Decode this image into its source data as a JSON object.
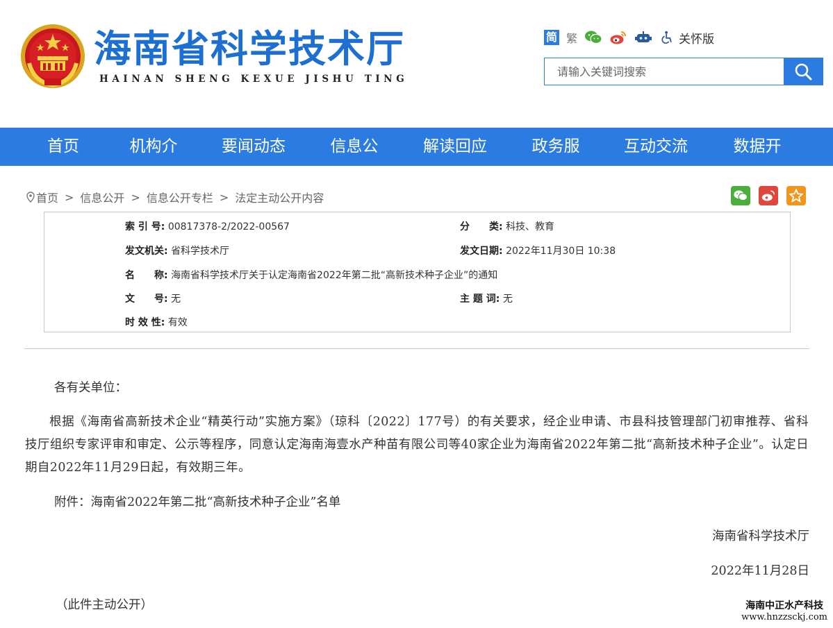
{
  "header": {
    "site_title": "海南省科学技术厅",
    "site_pinyin": "HAINAN SHENG KEXUE JISHU TING",
    "tools": {
      "simplified": "简",
      "traditional": "繁",
      "care_mode": "关怀版"
    },
    "search": {
      "placeholder": "请输入关键词搜索"
    }
  },
  "nav": {
    "items": [
      {
        "label": "首页"
      },
      {
        "label": "机构介绍"
      },
      {
        "label": "要闻动态"
      },
      {
        "label": "信息公开"
      },
      {
        "label": "解读回应"
      },
      {
        "label": "政务服务"
      },
      {
        "label": "互动交流"
      },
      {
        "label": "数据开放"
      }
    ]
  },
  "breadcrumb": [
    "首页",
    "信息公开",
    "信息公开专栏",
    "法定主动公开内容"
  ],
  "info": {
    "index_label": "索 引 号:",
    "index_value": "00817378-2/2022-00567",
    "category_label": "分　　类:",
    "category_value": "科技、教育",
    "issuer_label": "发文机关:",
    "issuer_value": "省科学技术厅",
    "date_label": "发文日期:",
    "date_value": "2022年11月30日 10:38",
    "name_label": "名　　称:",
    "name_value": "海南省科学技术厅关于认定海南省2022年第二批“高新技术种子企业”的通知",
    "doc_no_label": "文　　号:",
    "doc_no_value": "无",
    "subject_label": "主 题 词:",
    "subject_value": "无",
    "validity_label": "时 效 性:",
    "validity_value": "有效"
  },
  "content": {
    "salutation": "各有关单位：",
    "paragraph": "根据《海南省高新技术企业“精英行动”实施方案》（琼科〔2022〕177号）的有关要求，经企业申请、市县科技管理部门初审推荐、省科技厅组织专家评审和审定、公示等程序，同意认定海南海壹水产种苗有限公司等40家企业为海南省2022年第二批“高新技术种子企业”。认定日期自2022年11月29日起，有效期三年。",
    "attachment": "附件：海南省2022年第二批“高新技术种子企业”名单",
    "signature": "海南省科学技术厅",
    "sign_date": "2022年11月28日",
    "disclosure": "（此件主动公开）"
  },
  "watermark": {
    "name": "海南中正水产科技",
    "url": "www.hnzzsckj.com"
  },
  "colors": {
    "brand_blue": "#2c7be0",
    "title_blue": "#1d6fd1",
    "wechat_green": "#4cae3a",
    "weibo_red": "#e0473c",
    "favorite_orange": "#f0961e"
  }
}
